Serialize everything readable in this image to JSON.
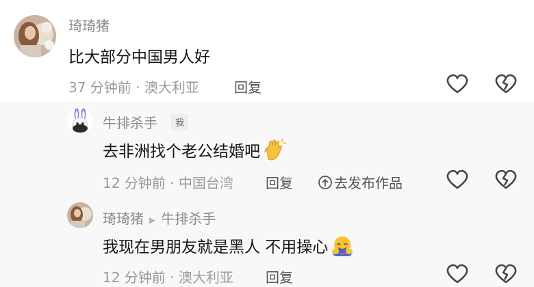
{
  "comments": [
    {
      "username": "琦琦猪",
      "text": "比大部分中国男人好",
      "meta": "37 分钟前 · 澳大利亚",
      "reply_label": "回复"
    },
    {
      "username": "牛排杀手",
      "badge": "我",
      "text": "去非洲找个老公结婚吧",
      "emoji": "clapping-hands",
      "meta": "12 分钟前 · 中国台湾",
      "reply_label": "回复",
      "share_label": "去发布作品"
    },
    {
      "username": "琦琦猪",
      "reply_to": "牛排杀手",
      "text": "我现在男朋友就是黑人 不用操心",
      "emoji": "hugging-face",
      "meta": "12 分钟前 · 澳大利亚",
      "reply_label": "回复"
    }
  ],
  "icons": {
    "like": "heart-outline-icon",
    "dislike": "broken-heart-icon",
    "share": "share-arrow-circle-icon",
    "reply_arrow": "triangle-right-icon"
  },
  "colors": {
    "username": "#8a8a8a",
    "text": "#161616",
    "meta": "#9a9a9a",
    "reply_bg": "#f8f8f8"
  }
}
